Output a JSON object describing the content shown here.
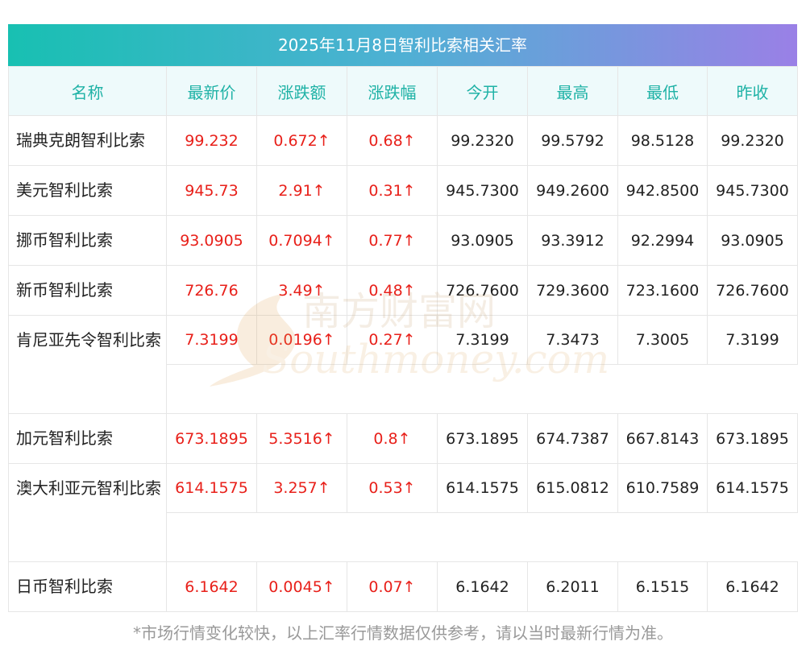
{
  "title": "2025年11月8日智利比索相关汇率",
  "headers": [
    "名称",
    "最新价",
    "涨跌额",
    "涨跌幅",
    "今开",
    "最高",
    "最低",
    "昨收"
  ],
  "rows": [
    {
      "name": "瑞典克朗智利比索",
      "latest": "99.232",
      "change": "0.672↑",
      "pct": "0.68↑",
      "open": "99.2320",
      "high": "99.5792",
      "low": "98.5128",
      "prev": "99.2320"
    },
    {
      "name": "美元智利比索",
      "latest": "945.73",
      "change": "2.91↑",
      "pct": "0.31↑",
      "open": "945.7300",
      "high": "949.2600",
      "low": "942.8500",
      "prev": "945.7300"
    },
    {
      "name": "挪币智利比索",
      "latest": "93.0905",
      "change": "0.7094↑",
      "pct": "0.77↑",
      "open": "93.0905",
      "high": "93.3912",
      "low": "92.2994",
      "prev": "93.0905"
    },
    {
      "name": "新币智利比索",
      "latest": "726.76",
      "change": "3.49↑",
      "pct": "0.48↑",
      "open": "726.7600",
      "high": "729.3600",
      "low": "723.1600",
      "prev": "726.7600"
    },
    {
      "name": "肯尼亚先令智利比索",
      "latest": "7.3199",
      "change": "0.0196↑",
      "pct": "0.27↑",
      "open": "7.3199",
      "high": "7.3473",
      "low": "7.3005",
      "prev": "7.3199"
    },
    {
      "name": "加元智利比索",
      "latest": "673.1895",
      "change": "5.3516↑",
      "pct": "0.8↑",
      "open": "673.1895",
      "high": "674.7387",
      "low": "667.8143",
      "prev": "673.1895"
    },
    {
      "name": "澳大利亚元智利比索",
      "latest": "614.1575",
      "change": "3.257↑",
      "pct": "0.53↑",
      "open": "614.1575",
      "high": "615.0812",
      "low": "610.7589",
      "prev": "614.1575"
    },
    {
      "name": "日币智利比索",
      "latest": "6.1642",
      "change": "0.0045↑",
      "pct": "0.07↑",
      "open": "6.1642",
      "high": "6.2011",
      "low": "6.1515",
      "prev": "6.1642"
    }
  ],
  "watermark": {
    "cn": "南方财富网",
    "en": "Southmoney.com"
  },
  "footnote": "*市场行情变化较快，以上汇率行情数据仅供参考，请以当时最新行情为准。",
  "colors": {
    "up": "#e8201a",
    "header_text": "#1fb2a6",
    "title_gradient_start": "#18c0b2",
    "title_gradient_end": "#9a80e6"
  }
}
